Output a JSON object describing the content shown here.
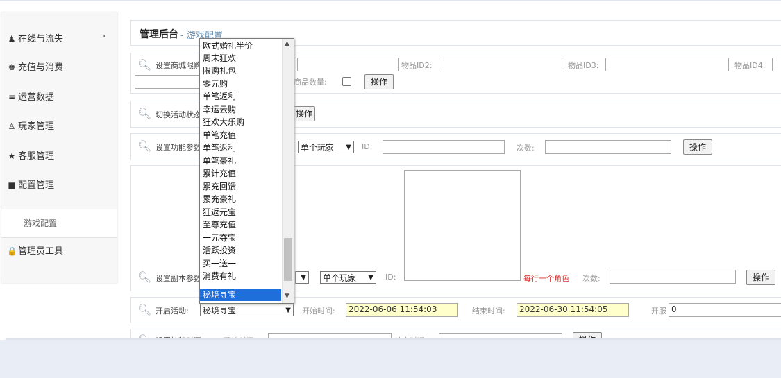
{
  "sidebar": {
    "items": [
      {
        "icon": "user-icon",
        "label": "在线与流失"
      },
      {
        "icon": "cup-icon",
        "label": "充值与消费"
      },
      {
        "icon": "list-icon",
        "label": "运营数据"
      },
      {
        "icon": "person-icon",
        "label": "玩家管理"
      },
      {
        "icon": "star-icon",
        "label": "客服管理"
      },
      {
        "icon": "book-icon",
        "label": "配置管理"
      },
      {
        "icon": "lock-icon",
        "label": "管理员工具"
      }
    ],
    "sub_item": "游戏配置",
    "dot": "·"
  },
  "header": {
    "title": "管理后台",
    "separator_sub": "- 游戏配置"
  },
  "row_mall": {
    "label": "设置商城限购",
    "item2": "物品ID2:",
    "item3": "物品ID3:",
    "item4": "物品ID4:",
    "count_label": "据商品数量:",
    "button": "操作"
  },
  "row_toggle": {
    "label": "切换活动状态",
    "button": "操作"
  },
  "row_func": {
    "label": "设置功能参数",
    "player_select": "单个玩家",
    "id_label": "ID:",
    "times_label": "次数:",
    "button": "操作"
  },
  "row_dungeon": {
    "label": "设置副本参数",
    "player_select": "单个玩家",
    "id_label": "ID:",
    "hint": "每行一个角色",
    "times_label": "次数:",
    "button": "操作"
  },
  "row_open": {
    "label": "开启活动:",
    "activity_select": "秘境寻宝",
    "start_label": "开始时间:",
    "start_value": "2022-06-06 11:54:03",
    "end_label": "结束时间:",
    "end_value": "2022-06-30 11:54:05",
    "server_label": "开服",
    "server_value": "0"
  },
  "row_last": {
    "label": "设置抽奖时间",
    "start_label": "开始时间:",
    "end_label": "结束时间:",
    "button": "操作"
  },
  "dropdown": {
    "options": [
      "欧式婚礼半价",
      "周末狂欢",
      "限购礼包",
      "零元购",
      "单笔返利",
      "幸运云购",
      "狂欢大乐购",
      "单笔充值",
      "单笔返利",
      "单笔豪礼",
      "累计充值",
      "累充回馈",
      "累充豪礼",
      "狂返元宝",
      "至尊充值",
      "一元夺宝",
      "活跃投资",
      "买一送一",
      "消费有礼",
      "秘境寻宝"
    ],
    "selected": "秘境寻宝"
  },
  "colors": {
    "accent": "#1e6fd9",
    "highlight_input": "#ffffcc",
    "hint_red": "#d9302f"
  }
}
